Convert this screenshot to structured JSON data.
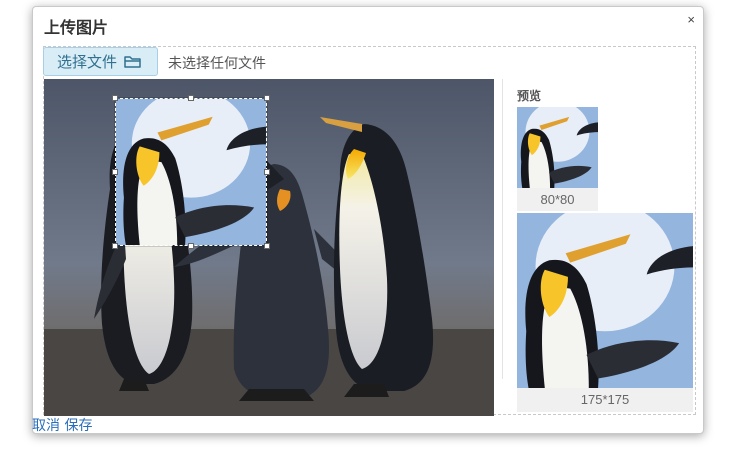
{
  "dialog": {
    "title": "上传图片",
    "close_glyph": "×"
  },
  "file_picker": {
    "button_label": "选择文件",
    "button_icon": "folder-open-icon",
    "status_text": "未选择任何文件"
  },
  "preview": {
    "label": "预览",
    "small_caption": "80*80",
    "large_caption": "175*175"
  },
  "footer": {
    "cancel_label": "取消",
    "save_label": "保存"
  },
  "colors": {
    "button_bg": "#d9edf7",
    "button_text": "#31708f",
    "link": "#2a6ebb"
  }
}
